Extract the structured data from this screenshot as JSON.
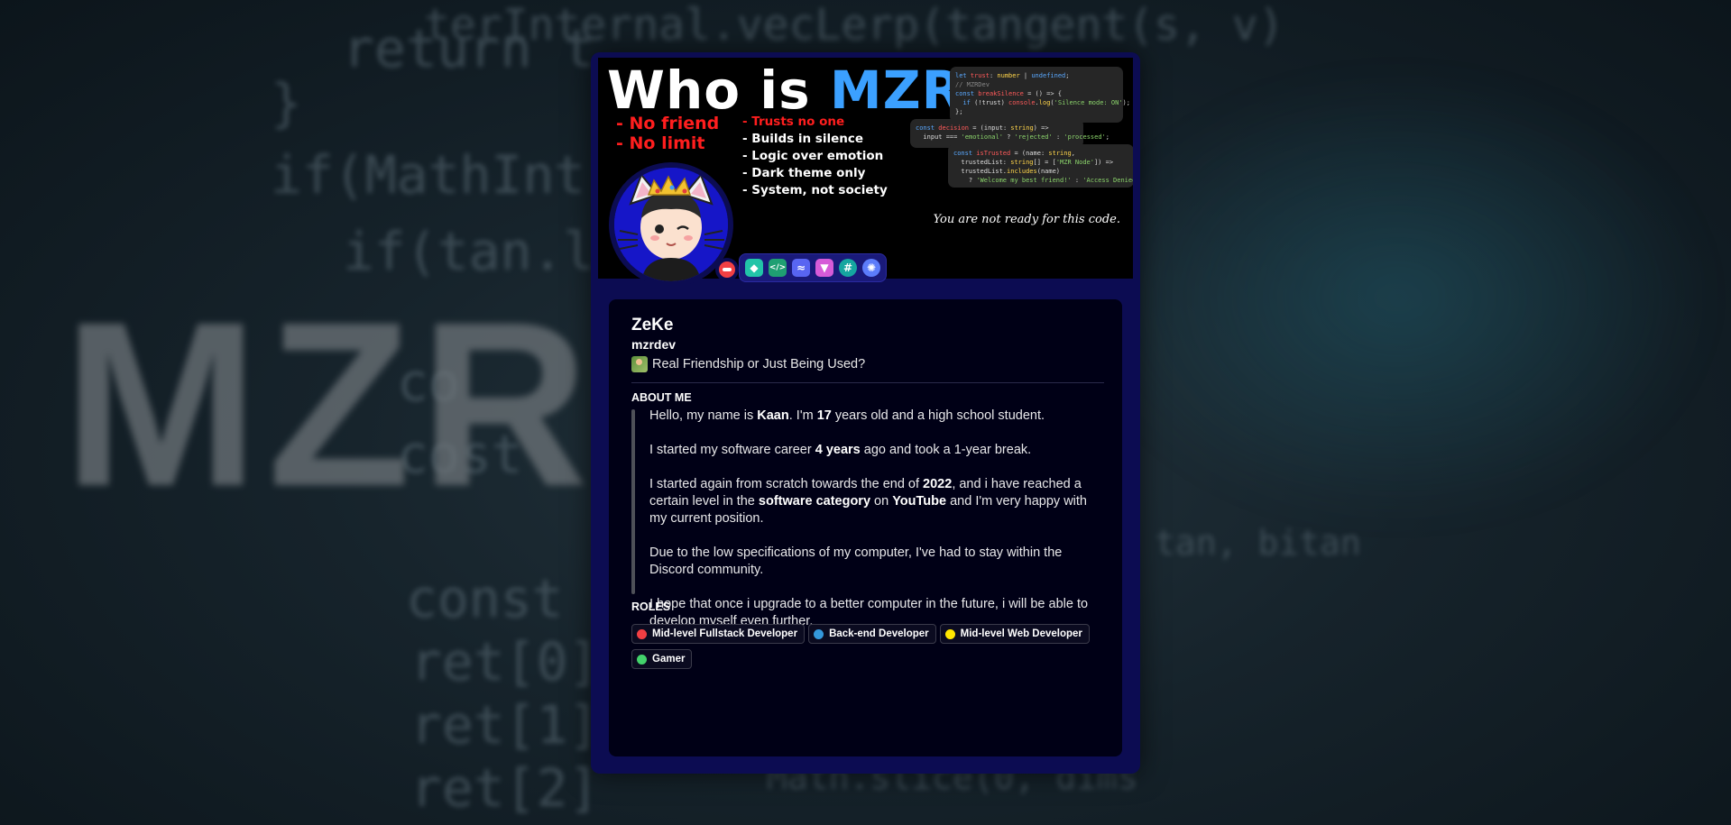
{
  "background": {
    "big_text": "MZRDEV",
    "code_lines": [
      "return t",
      "}",
      "if(MathInt",
      "if(tan.l",
      "co",
      "cost",
      "const",
      "ret[0]",
      "ret[1]",
      "ret[2]",
      "terInternal.vecLerp(tangent(s, v)",
      "Math.slice(0, dims",
      "tan, bitan"
    ]
  },
  "banner": {
    "title_prefix": "Who is ",
    "title_highlight": "MZR",
    "title_suffix": "?",
    "red_items": [
      "- No friend",
      "- No limit"
    ],
    "white_items": [
      "- Trusts no one",
      "- Builds in silence",
      "- Logic over emotion",
      "- Dark theme only",
      "- System, not society"
    ],
    "tagline": "You are not ready for this code."
  },
  "profile": {
    "display_name": "ZeKe",
    "username": "mzrdev",
    "custom_status": "Real Friendship or Just Being Used?",
    "status": "do-not-disturb",
    "badges": [
      {
        "icon": "hypesquad-icon",
        "color": "#22c4a8",
        "glyph": "◆"
      },
      {
        "icon": "active-developer-icon",
        "color": "#1f9f72",
        "glyph": "</>"
      },
      {
        "icon": "speed-icon",
        "color": "#5865f2",
        "glyph": "≈"
      },
      {
        "icon": "nitro-gem-icon",
        "color": "#d65bd8",
        "glyph": "▼"
      },
      {
        "icon": "hashtag-icon",
        "color": "#15a6a0",
        "glyph": "#"
      },
      {
        "icon": "server-booster-icon",
        "color": "#5c7cfa",
        "glyph": "✺"
      }
    ]
  },
  "about": {
    "heading": "ABOUT ME",
    "roles_heading": "ROLES"
  },
  "roles": [
    {
      "name": "Mid-level Fullstack Developer",
      "color": "#f23f43"
    },
    {
      "name": "Back-end Developer",
      "color": "#3498db"
    },
    {
      "name": "Mid-level Web Developer",
      "color": "#ffe600"
    },
    {
      "name": "Gamer",
      "color": "#43d36b"
    }
  ]
}
